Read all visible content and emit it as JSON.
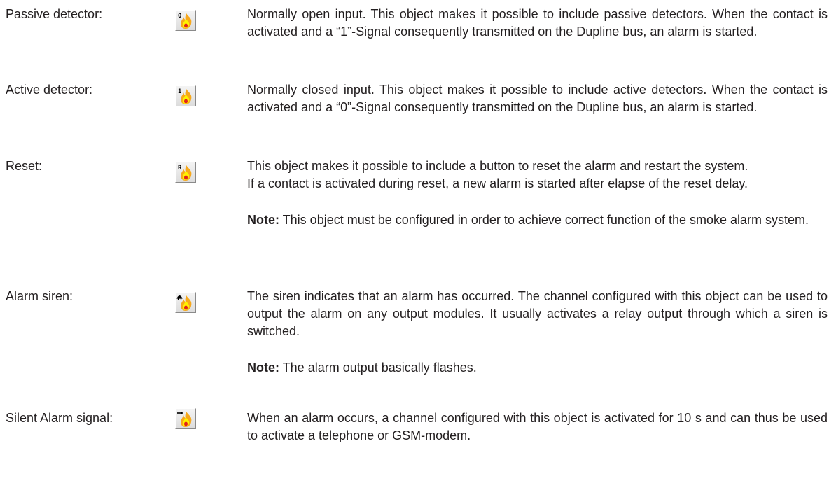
{
  "entries": [
    {
      "label": "Passive detector:",
      "icon_name": "passive-detector-icon",
      "icon_badge": "0",
      "text": "Normally open input. This object makes it possible to include passive detectors. When the contact is activated and a “1”-Signal consequently transmitted on the Dupline bus, an alarm is started."
    },
    {
      "label": "Active detector:",
      "icon_name": "active-detector-icon",
      "icon_badge": "1",
      "text": "Normally closed input. This object makes it possible to include active detectors. When the contact is activated and a “0”-Signal consequently transmitted on the Dupline bus, an alarm is started."
    },
    {
      "label": "Reset:",
      "icon_name": "reset-icon",
      "icon_badge": "R",
      "text": "This object makes it possible to include a button to reset the alarm and restart the system.",
      "text2": "If a contact is activated during reset, a new alarm is started after elapse of the reset delay.",
      "note_label": "Note:",
      "note": " This object must be configured in order to achieve correct function of the smoke alarm system."
    },
    {
      "label": "Alarm siren:",
      "icon_name": "alarm-siren-icon",
      "icon_badge": "siren",
      "text": "The siren indicates that an alarm has occurred. The channel configured with this object can be used to output the alarm on any output modules. It usually activates a relay output through which a siren is switched.",
      "note_label": "Note:",
      "note": " The alarm output basically flashes."
    },
    {
      "label": "Silent Alarm signal:",
      "icon_name": "silent-alarm-signal-icon",
      "icon_badge": "arrow",
      "text": "When an alarm occurs, a channel configured with this object is activated for 10 s and can thus be used to activate a telephone or GSM-modem."
    }
  ],
  "colors": {
    "text": "#231f20",
    "flame_outer": "#f7a81b",
    "flame_inner": "#fff200",
    "flame_core": "#e2231a",
    "icon_bg": "#e6e6e6"
  }
}
